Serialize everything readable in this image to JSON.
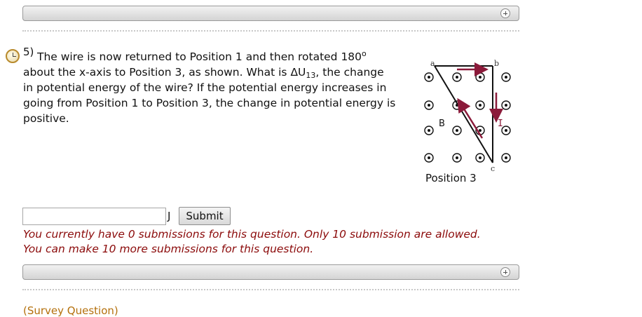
{
  "question": {
    "number": "5)",
    "line1_text": "The wire is now returned to Position 1 and then rotated 180",
    "line1_sup": "o",
    "line2_before": "about the x-axis to Position 3, as shown. What is ΔU",
    "line2_sub": "13",
    "line2_after": ", the change",
    "line3": "in potential energy of the wire? If the potential energy increases in",
    "line4": "going from Position 1 to Position 3, the change in potential energy is",
    "line5": "positive."
  },
  "figure": {
    "label_a": "a",
    "label_b": "b",
    "label_c": "c",
    "label_B": "B",
    "label_I": "I",
    "caption": "Position 3"
  },
  "answer": {
    "value": "",
    "unit": "J",
    "submit_label": "Submit"
  },
  "notices": {
    "line1": "You currently have 0 submissions for this question. Only 10 submission are allowed.",
    "line2": "You can make 10 more submissions for this question."
  },
  "survey_link": "(Survey Question)",
  "colors": {
    "notice": "#8b0a0a",
    "link": "#b4700c",
    "arrow": "#8b1a3a"
  }
}
